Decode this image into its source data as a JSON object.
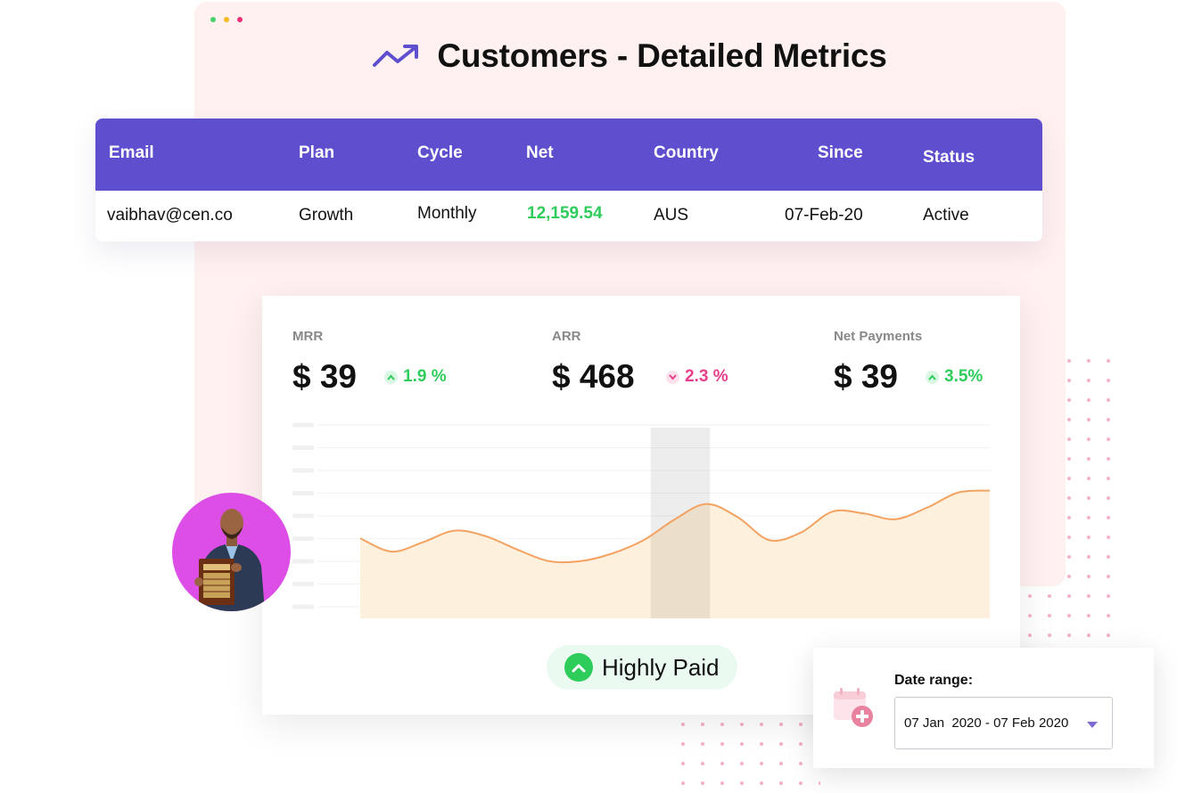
{
  "window": {
    "dot_colors": [
      "#47d16c",
      "#f5b921",
      "#e8307a"
    ]
  },
  "header": {
    "icon": "trending-up-icon",
    "title": "Customers - Detailed Metrics"
  },
  "table": {
    "columns": [
      "Email",
      "Plan",
      "Cycle",
      "Net",
      "Country",
      "Since",
      "Status"
    ],
    "rows": [
      {
        "email": "vaibhav@cen.co",
        "plan": "Growth",
        "cycle": "Monthly",
        "net": "12,159.54",
        "country": "AUS",
        "since": "07-Feb-20",
        "status": "Active"
      }
    ]
  },
  "metrics": [
    {
      "label": "MRR",
      "value": "$ 39",
      "delta": "1.9 %",
      "direction": "up"
    },
    {
      "label": "ARR",
      "value": "$ 468",
      "delta": "2.3 %",
      "direction": "down"
    },
    {
      "label": "Net Payments",
      "value": "$ 39",
      "delta": "3.5%",
      "direction": "up"
    }
  ],
  "badge": {
    "icon": "chevron-up-circle-icon",
    "label": "Highly Paid"
  },
  "date_range": {
    "label": "Date range:",
    "value": "07 Jan  2020 - 07 Feb 2020",
    "icon": "calendar-add-icon"
  },
  "colors": {
    "accent": "#5e4fce",
    "positive": "#2ecc5b",
    "negative": "#e83e8c",
    "chart_line": "#f4a261",
    "chart_fill": "#fdf0dc",
    "window_bg": "#fff1f0",
    "avatar_bg": "#dd4ee6"
  },
  "chart_data": {
    "type": "area",
    "x": [
      0,
      1,
      2,
      3,
      4,
      5,
      6,
      7,
      8,
      9,
      10,
      11,
      12,
      13,
      14,
      15,
      16,
      17,
      18,
      19,
      20
    ],
    "values": [
      42,
      35,
      40,
      46,
      43,
      36,
      30,
      30,
      34,
      41,
      52,
      60,
      53,
      41,
      45,
      56,
      55,
      52,
      58,
      66,
      67
    ],
    "ylim": [
      0,
      100
    ],
    "highlight_x": [
      9,
      11
    ],
    "grid": true
  }
}
